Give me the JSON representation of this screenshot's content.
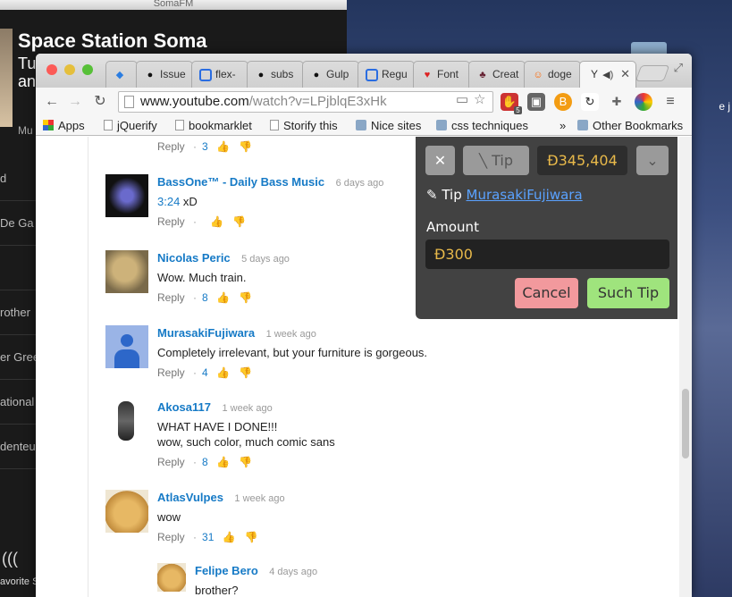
{
  "soma": {
    "window_title": "SomaFM",
    "station_title": "Space Station Soma",
    "subline1": "Tu",
    "subline2": "an",
    "side_items": [
      "d",
      "De Ga",
      "",
      "rother",
      "er Gree",
      "ational",
      "denteu"
    ],
    "footer": "avorite S",
    "mu": "Mu"
  },
  "desktop": {
    "right_text": "e j"
  },
  "tabs": [
    {
      "label": "",
      "icon": "kanban-icon"
    },
    {
      "label": "Issue",
      "icon": "github-icon"
    },
    {
      "label": "flex-",
      "icon": "bookmark-icon"
    },
    {
      "label": "subs",
      "icon": "github-icon"
    },
    {
      "label": "Gulp",
      "icon": "github-icon"
    },
    {
      "label": "Regu",
      "icon": "bookmark-icon"
    },
    {
      "label": "Font",
      "icon": "heart-icon"
    },
    {
      "label": "Creat",
      "icon": "mushroom-icon"
    },
    {
      "label": "doge",
      "icon": "reddit-icon"
    },
    {
      "label": "Y",
      "icon": "speaker-icon"
    }
  ],
  "omnibox": {
    "host": "www.youtube.com",
    "path": "/watch?v=LPjblqE3xHk"
  },
  "extensions": {
    "badge": "5"
  },
  "bookmarks": {
    "apps": "Apps",
    "items": [
      "jQuerify",
      "bookmarklet",
      "Storify this",
      "Nice sites",
      "css techniques"
    ],
    "chevron": "»",
    "other": "Other Bookmarks"
  },
  "comments": [
    {
      "author": "",
      "time": "",
      "text": "",
      "reply": "Reply",
      "likes": "3"
    },
    {
      "author": "BassOne™ - Daily Bass Music",
      "time": "6 days ago",
      "timestamp": "3:24",
      "text": " xD",
      "reply": "Reply",
      "likes": ""
    },
    {
      "author": "Nicolas Peric",
      "time": "5 days ago",
      "text": "Wow. Much train.",
      "reply": "Reply",
      "likes": "8"
    },
    {
      "author": "MurasakiFujiwara",
      "time": "1 week ago",
      "text": "Completely irrelevant, but your furniture is gorgeous.",
      "reply": "Reply",
      "likes": "4"
    },
    {
      "author": "Akosa117",
      "time": "1 week ago",
      "text": "WHAT HAVE I DONE!!!",
      "text2": "wow, such color, much comic sans",
      "reply": "Reply",
      "likes": "8"
    },
    {
      "author": "AtlasVulpes",
      "time": "1 week ago",
      "text": "wow",
      "reply": "Reply",
      "likes": "31"
    },
    {
      "author": "Felipe Bero",
      "time": "4 days ago",
      "text": "brother?"
    }
  ],
  "tip": {
    "close": "✕",
    "tip_button": "Tip",
    "balance": "Đ345,404",
    "tip_label": "Tip",
    "recipient": "MurasakiFujiwara",
    "amount_label": "Amount",
    "amount_value": "Đ300",
    "cancel": "Cancel",
    "submit": "Such Tip"
  }
}
